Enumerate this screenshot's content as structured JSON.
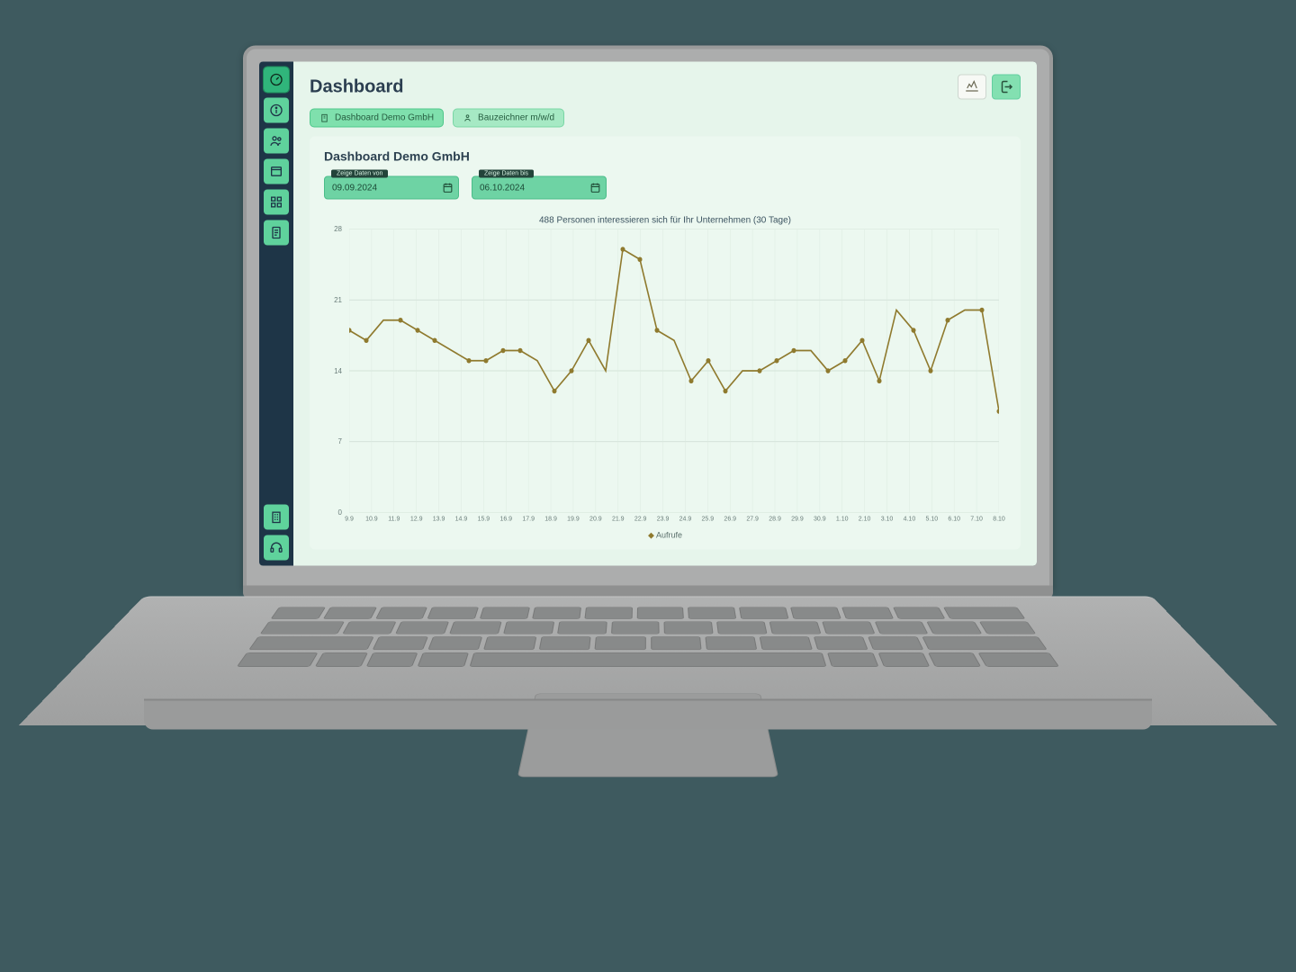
{
  "colors": {
    "accent": "#5fd29c",
    "sidebar_bg": "#1e3547",
    "line": "#8f7a2e"
  },
  "header": {
    "title": "Dashboard"
  },
  "sidebar": {
    "items": [
      {
        "name": "gauge-icon"
      },
      {
        "name": "info-icon"
      },
      {
        "name": "people-icon"
      },
      {
        "name": "window-icon"
      },
      {
        "name": "grid-icon"
      },
      {
        "name": "document-icon"
      }
    ],
    "bottom_items": [
      {
        "name": "building-icon"
      },
      {
        "name": "headset-icon"
      }
    ]
  },
  "tabs": [
    {
      "label": "Dashboard Demo GmbH",
      "active": true
    },
    {
      "label": "Bauzeichner m/w/d",
      "active": false
    }
  ],
  "card": {
    "title": "Dashboard Demo GmbH",
    "date_from_label": "Zeige Daten von",
    "date_from_value": "09.09.2024",
    "date_to_label": "Zeige Daten bis",
    "date_to_value": "06.10.2024"
  },
  "chart_data": {
    "type": "line",
    "title": "488 Personen interessieren sich für Ihr Unternehmen (30 Tage)",
    "xlabel": "",
    "ylabel": "",
    "ylim": [
      0,
      28
    ],
    "y_ticks": [
      0,
      7,
      14,
      21,
      28
    ],
    "categories": [
      "9.9",
      "10.9",
      "11.9",
      "12.9",
      "13.9",
      "14.9",
      "15.9",
      "16.9",
      "17.9",
      "18.9",
      "19.9",
      "20.9",
      "21.9",
      "22.9",
      "23.9",
      "24.9",
      "25.9",
      "26.9",
      "27.9",
      "28.9",
      "29.9",
      "30.9",
      "1.10",
      "2.10",
      "3.10",
      "4.10",
      "5.10",
      "6.10",
      "7.10",
      "8.10"
    ],
    "series": [
      {
        "name": "Aufrufe",
        "values": [
          18,
          17,
          19,
          19,
          18,
          17,
          16,
          15,
          15,
          16,
          16,
          15,
          12,
          14,
          17,
          14,
          26,
          25,
          18,
          17,
          13,
          15,
          12,
          14,
          14,
          15,
          16,
          16,
          14,
          15,
          17,
          13,
          20,
          18,
          14,
          19,
          20,
          20,
          10
        ]
      }
    ],
    "legend": "Aufrufe"
  }
}
